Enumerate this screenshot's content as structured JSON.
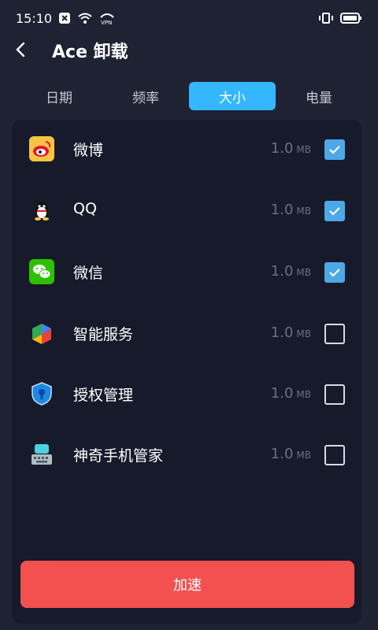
{
  "status": {
    "time": "15:10",
    "icons": [
      "close-box-icon",
      "wifi-icon",
      "vpn-icon",
      "vibrate-icon",
      "battery-icon"
    ]
  },
  "header": {
    "title": "Ace 卸载",
    "back_icon": "back-chevron-icon"
  },
  "tabs": [
    {
      "label": "日期",
      "active": false
    },
    {
      "label": "频率",
      "active": false
    },
    {
      "label": "大小",
      "active": true
    },
    {
      "label": "电量",
      "active": false
    }
  ],
  "apps": [
    {
      "name": "微博",
      "size": "1.0",
      "unit": "MB",
      "checked": true,
      "icon": "weibo-icon"
    },
    {
      "name": "QQ",
      "size": "1.0",
      "unit": "MB",
      "checked": true,
      "icon": "qq-icon"
    },
    {
      "name": "微信",
      "size": "1.0",
      "unit": "MB",
      "checked": true,
      "icon": "wechat-icon"
    },
    {
      "name": "智能服务",
      "size": "1.0",
      "unit": "MB",
      "checked": false,
      "icon": "smart-service-icon"
    },
    {
      "name": "授权管理",
      "size": "1.0",
      "unit": "MB",
      "checked": false,
      "icon": "shield-lock-icon"
    },
    {
      "name": "神奇手机管家",
      "size": "1.0",
      "unit": "MB",
      "checked": false,
      "icon": "keyboard-icon"
    }
  ],
  "action": {
    "label": "加速"
  },
  "colors": {
    "background": "#1f2233",
    "panel": "#171a2a",
    "accent_tab": "#34b7ff",
    "checkbox_on": "#4da8e8",
    "action_button": "#f35050"
  }
}
